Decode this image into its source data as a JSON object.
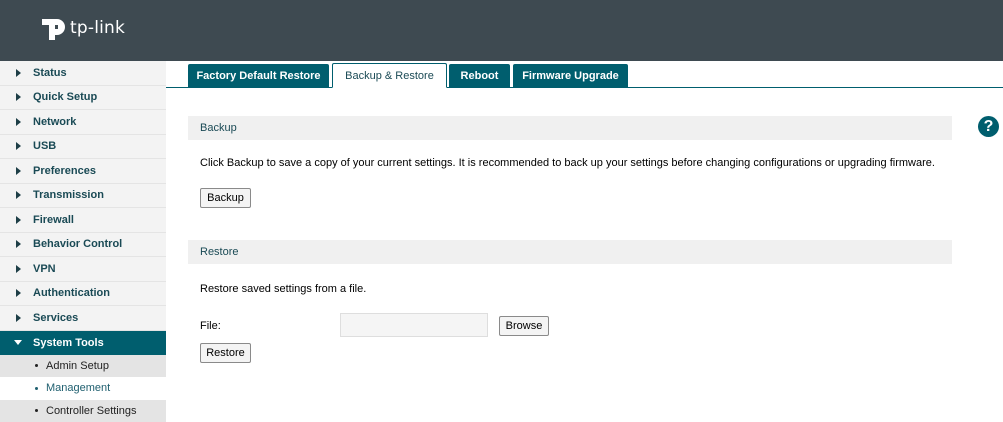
{
  "brand": {
    "logo_text": "tp-link"
  },
  "sidebar": {
    "items": [
      {
        "label": "Status"
      },
      {
        "label": "Quick Setup"
      },
      {
        "label": "Network"
      },
      {
        "label": "USB"
      },
      {
        "label": "Preferences"
      },
      {
        "label": "Transmission"
      },
      {
        "label": "Firewall"
      },
      {
        "label": "Behavior Control"
      },
      {
        "label": "VPN"
      },
      {
        "label": "Authentication"
      },
      {
        "label": "Services"
      },
      {
        "label": "System Tools"
      }
    ],
    "subitems": [
      {
        "label": "Admin Setup"
      },
      {
        "label": "Management"
      },
      {
        "label": "Controller Settings"
      }
    ]
  },
  "tabs": [
    {
      "label": "Factory Default Restore"
    },
    {
      "label": "Backup & Restore"
    },
    {
      "label": "Reboot"
    },
    {
      "label": "Firmware Upgrade"
    }
  ],
  "backup": {
    "title": "Backup",
    "description": "Click Backup to save a copy of your current settings. It is recommended to back up your settings before changing configurations or upgrading firmware.",
    "button_label": "Backup"
  },
  "restore": {
    "title": "Restore",
    "description": "Restore saved settings from a file.",
    "file_label": "File:",
    "file_value": "",
    "browse_label": "Browse",
    "button_label": "Restore"
  },
  "help": {
    "glyph": "?"
  },
  "colors": {
    "header": "#3e4a51",
    "accent": "#005e6e"
  }
}
